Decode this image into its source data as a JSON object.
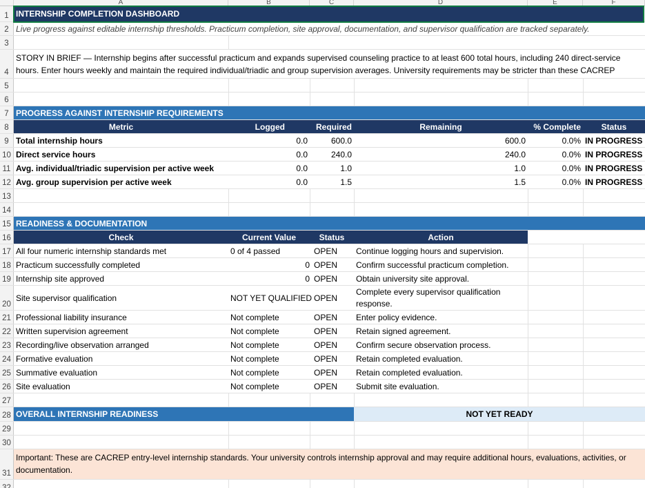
{
  "columns": [
    "A",
    "B",
    "C",
    "D",
    "E",
    "F"
  ],
  "row_numbers": [
    "1",
    "2",
    "3",
    "4",
    "5",
    "6",
    "7",
    "8",
    "9",
    "10",
    "11",
    "12",
    "13",
    "14",
    "15",
    "16",
    "17",
    "18",
    "19",
    "20",
    "21",
    "22",
    "23",
    "24",
    "25",
    "26",
    "27",
    "28",
    "29",
    "30",
    "31",
    "32"
  ],
  "title": "INTERNSHIP COMPLETION DASHBOARD",
  "subtitle": "Live progress against editable internship thresholds. Practicum completion, site approval, documentation, and supervisor qualification are tracked separately.",
  "story": "STORY IN BRIEF — Internship begins after successful practicum and expands supervised counseling practice to at least 600 total hours, including 240 direct-service hours. Enter hours weekly and maintain the required individual/triadic and group supervision averages. University requirements may be stricter than these CACREP",
  "progress": {
    "section_title": "PROGRESS AGAINST INTERNSHIP REQUIREMENTS",
    "headers": {
      "metric": "Metric",
      "logged": "Logged",
      "required": "Required",
      "remaining": "Remaining",
      "pct": "% Complete",
      "status": "Status"
    },
    "rows": [
      {
        "metric": "Total internship hours",
        "logged": "0.0",
        "required": "600.0",
        "remaining": "600.0",
        "pct": "0.0%",
        "status": "IN PROGRESS"
      },
      {
        "metric": "Direct service hours",
        "logged": "0.0",
        "required": "240.0",
        "remaining": "240.0",
        "pct": "0.0%",
        "status": "IN PROGRESS"
      },
      {
        "metric": "Avg. individual/triadic supervision per active week",
        "logged": "0.0",
        "required": "1.0",
        "remaining": "1.0",
        "pct": "0.0%",
        "status": "IN PROGRESS"
      },
      {
        "metric": "Avg. group supervision per active week",
        "logged": "0.0",
        "required": "1.5",
        "remaining": "1.5",
        "pct": "0.0%",
        "status": "IN PROGRESS"
      }
    ]
  },
  "readiness": {
    "section_title": "READINESS & DOCUMENTATION",
    "headers": {
      "check": "Check",
      "current": "Current Value",
      "status": "Status",
      "action": "Action"
    },
    "rows": [
      {
        "check": "All four numeric internship standards met",
        "current": "0 of 4 passed",
        "num": "",
        "status": "OPEN",
        "action": "Continue logging hours and supervision."
      },
      {
        "check": "Practicum successfully completed",
        "current": "",
        "num": "0",
        "status": "OPEN",
        "action": "Confirm successful practicum completion."
      },
      {
        "check": "Internship site approved",
        "current": "",
        "num": "0",
        "status": "OPEN",
        "action": "Obtain university site approval."
      },
      {
        "check": "Site supervisor qualification",
        "current": "NOT YET QUALIFIED",
        "num": "",
        "status": "OPEN",
        "action": "Complete every supervisor qualification response."
      },
      {
        "check": "Professional liability insurance",
        "current": "Not complete",
        "num": "",
        "status": "OPEN",
        "action": "Enter policy evidence."
      },
      {
        "check": "Written supervision agreement",
        "current": "Not complete",
        "num": "",
        "status": "OPEN",
        "action": "Retain signed agreement."
      },
      {
        "check": "Recording/live observation arranged",
        "current": "Not complete",
        "num": "",
        "status": "OPEN",
        "action": "Confirm secure observation process."
      },
      {
        "check": "Formative evaluation",
        "current": "Not complete",
        "num": "",
        "status": "OPEN",
        "action": "Retain completed evaluation."
      },
      {
        "check": "Summative evaluation",
        "current": "Not complete",
        "num": "",
        "status": "OPEN",
        "action": "Retain completed evaluation."
      },
      {
        "check": "Site evaluation",
        "current": "Not complete",
        "num": "",
        "status": "OPEN",
        "action": "Submit site evaluation."
      }
    ]
  },
  "overall": {
    "label": "OVERALL INTERNSHIP READINESS",
    "value": "NOT YET READY"
  },
  "note": "Important: These are CACREP entry-level internship standards. Your university controls internship approval and may require additional hours, evaluations, activities, or documentation.",
  "colors": {
    "navy": "#1f3864",
    "section_blue": "#2e75b6",
    "ready_bg": "#ddebf7",
    "note_bg": "#fce4d6",
    "selection": "#107c41"
  }
}
